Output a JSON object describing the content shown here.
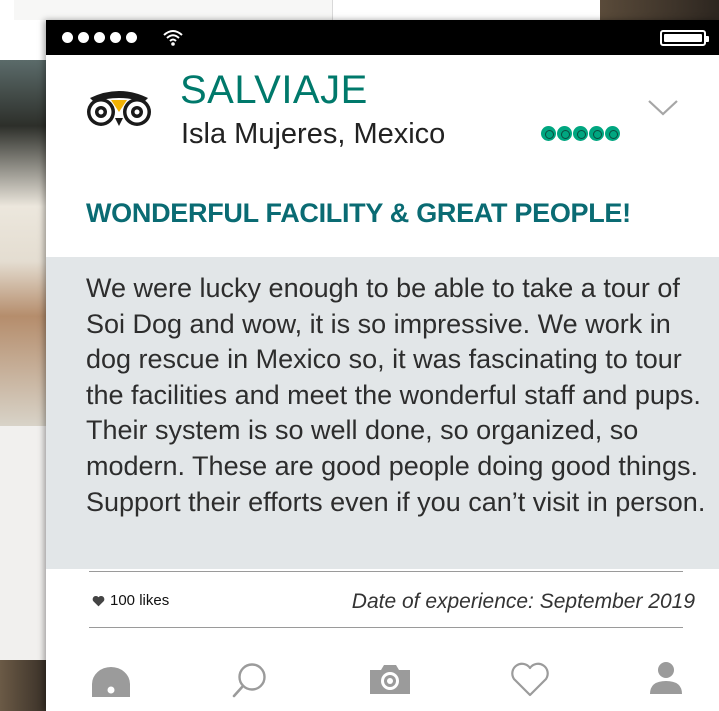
{
  "status_bar": {
    "signal_icon": "signal-dots-icon",
    "wifi_icon": "wifi-icon",
    "battery_icon": "battery-icon"
  },
  "review": {
    "reviewer_name": "SALVIAJE",
    "reviewer_location": "Isla Mujeres, Mexico",
    "rating": 5,
    "rating_max": 5,
    "title": "WONDERFUL FACILITY & GREAT PEOPLE!",
    "body": "We were lucky enough to be able to take a tour of Soi Dog and wow, it is so impressive. We work in dog rescue in Mexico so, it was fascinating to tour the facilities and meet the wonderful staff and pups. Their system is so well done, so organized, so modern. These are good people doing good things. Support their efforts even if you can’t visit in person.",
    "likes_label": "100 likes",
    "experience_date": "Date of experience: September 2019"
  },
  "colors": {
    "brand_green": "#00a680",
    "name_teal": "#00796b",
    "title_teal": "#0a6b73",
    "body_box_bg": "#e2e6e8",
    "icon_gray": "#9b9b9b"
  },
  "tab_bar": {
    "tabs": [
      {
        "icon": "home-icon"
      },
      {
        "icon": "search-icon"
      },
      {
        "icon": "camera-icon"
      },
      {
        "icon": "heart-icon"
      },
      {
        "icon": "profile-icon"
      }
    ]
  }
}
